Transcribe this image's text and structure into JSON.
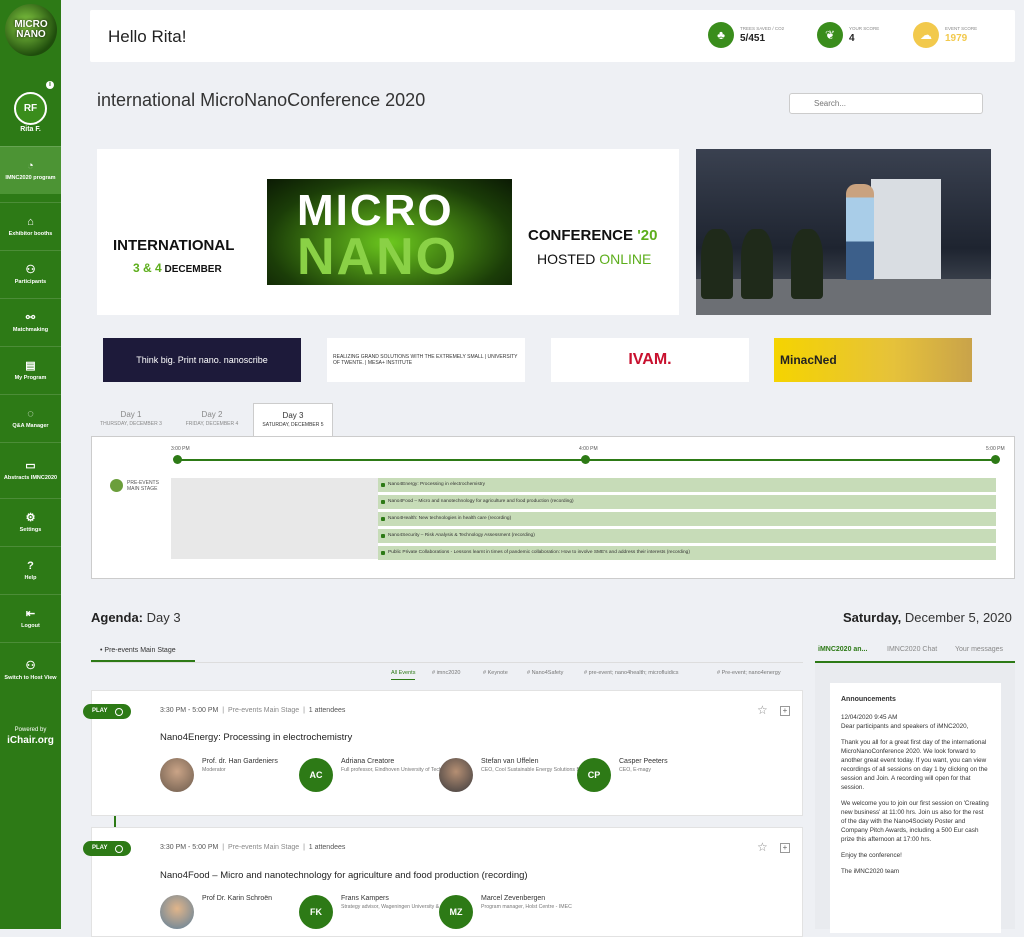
{
  "sidebar": {
    "logo_text": "MICRO NANO",
    "avatar_initials": "RF",
    "user_name": "Rita F.",
    "items": [
      {
        "label": "IMNC2020 program",
        "icon": "gauge-icon"
      },
      {
        "label": "Exhibitor booths",
        "icon": "booth-icon"
      },
      {
        "label": "Participants",
        "icon": "people-icon"
      },
      {
        "label": "Matchmaking",
        "icon": "matchmaking-icon"
      },
      {
        "label": "My Program",
        "icon": "clipboard-icon"
      },
      {
        "label": "Q&A Manager",
        "icon": "chat-icon"
      },
      {
        "label": "Abstracts IMNC2020",
        "icon": "abstracts-icon"
      },
      {
        "label": "Settings",
        "icon": "gear-icon"
      },
      {
        "label": "Help",
        "icon": "help-icon"
      },
      {
        "label": "Logout",
        "icon": "logout-icon"
      },
      {
        "label": "Switch to Host View",
        "icon": "host-icon"
      }
    ],
    "powered_label": "Powered by",
    "powered_brand": "iChair.org"
  },
  "header": {
    "greeting": "Hello Rita!",
    "stats": [
      {
        "label": "Trees saved / CO2",
        "value": "5/451",
        "color": "#3a8d1c"
      },
      {
        "label": "Your score",
        "value": "4",
        "color": "#3a8d1c"
      },
      {
        "label": "Event score",
        "value": "1979",
        "color": "#f2c94c"
      }
    ]
  },
  "page": {
    "title": "international MicroNanoConference 2020",
    "search_placeholder": "Search..."
  },
  "banner": {
    "international": "INTERNATIONAL",
    "dates": "3 & 4",
    "month": "DECEMBER",
    "micro": "MICRO",
    "nano": "NANO",
    "conference": "CONFERENCE",
    "year": "'20",
    "hosted": "HOSTED",
    "online": "ONLINE"
  },
  "sponsors": [
    {
      "name": "Think big. Print nano. nanoscribe"
    },
    {
      "name": "REALIZING GRAND SOLUTIONS WITH THE EXTREMELY SMALL | UNIVERSITY OF TWENTE. | MESA+ INSTITUTE"
    },
    {
      "name": "IVAM."
    },
    {
      "name": "MinacNed"
    }
  ],
  "days": [
    {
      "label": "Day 1",
      "date": "THURSDAY, DECEMBER 3"
    },
    {
      "label": "Day 2",
      "date": "FRIDAY, DECEMBER 4"
    },
    {
      "label": "Day 3",
      "date": "SATURDAY, DECEMBER 5"
    }
  ],
  "timeline": {
    "times": [
      "3:00 PM",
      "4:00 PM",
      "5:00 PM"
    ],
    "stage": "PRE-EVENTS MAIN STAGE",
    "sessions": [
      "Nano4Energy: Processing in electrochemistry",
      "Nano4Food – Micro and nanotechnology for agriculture and food production (recording)",
      "Nano4Health: New technologies in health care (recording)",
      "Nano4Security – Risk Analysis & Technology Assessment (recording)",
      "Public Private Collaborations - Lessons learnt in times of pandemic collaboration: How to involve SME's and address their interests (recording)"
    ]
  },
  "agenda": {
    "label": "Agenda:",
    "day": "Day 3",
    "date_day": "Saturday,",
    "date_rest": "December 5, 2020",
    "stage_tab": "Pre-events Main Stage",
    "filters": [
      "All Events",
      "# imnc2020",
      "# Keynote",
      "# Nano4Safety",
      "# pre-event; nano4health; microfluidics",
      "# Pre-event; nano4energy"
    ],
    "play_label": "PLAY",
    "cards": [
      {
        "time": "3:30 PM - 5:00 PM",
        "stage": "Pre-events Main Stage",
        "attendees": "1 attendees",
        "title": "Nano4Energy: Processing in electrochemistry",
        "people": [
          {
            "initials": "",
            "name": "Prof. dr. Han Gardeniers",
            "role": "Moderator"
          },
          {
            "initials": "AC",
            "name": "Adriana Creatore",
            "role": "Full professor, Eindhoven University of Technology"
          },
          {
            "initials": "",
            "name": "Stefan van Uffelen",
            "role": "CEO, Cool Sustainable Energy Solutions B.V."
          },
          {
            "initials": "CP",
            "name": "Casper Peeters",
            "role": "CEO, E-magy"
          }
        ]
      },
      {
        "time": "3:30 PM - 5:00 PM",
        "stage": "Pre-events Main Stage",
        "attendees": "1 attendees",
        "title": "Nano4Food – Micro and nanotechnology for agriculture and food production (recording)",
        "people": [
          {
            "initials": "",
            "name": "Prof Dr. Karin Schroën",
            "role": ""
          },
          {
            "initials": "FK",
            "name": "Frans Kampers",
            "role": "Strategy advisor, Wageningen University &"
          },
          {
            "initials": "MZ",
            "name": "Marcel Zevenbergen",
            "role": "Program manager, Holst Centre - IMEC"
          }
        ]
      }
    ]
  },
  "right_panel": {
    "tabs": [
      "iMNC2020 an...",
      "IMNC2020 Chat",
      "Your messages"
    ],
    "announcement_title": "Announcements",
    "timestamp": "12/04/2020 9:45 AM",
    "paragraphs": [
      "Dear participants and speakers of iMNC2020,",
      "Thank you all for a great first day of the international MicroNanoConference 2020. We look forward to another great event today. If you want, you can view recordings of all sessions on day 1 by clicking on the session and Join. A recording will open for that session.",
      "We welcome you to join our first session on 'Creating new business' at 11:00 hrs. Join us also for the rest of the day with the Nano4Society Poster and Company Pitch Awards, including a 500 Eur cash prize this afternoon at 17:00 hrs.",
      "Enjoy the conference!",
      "The iMNC2020 team"
    ]
  }
}
